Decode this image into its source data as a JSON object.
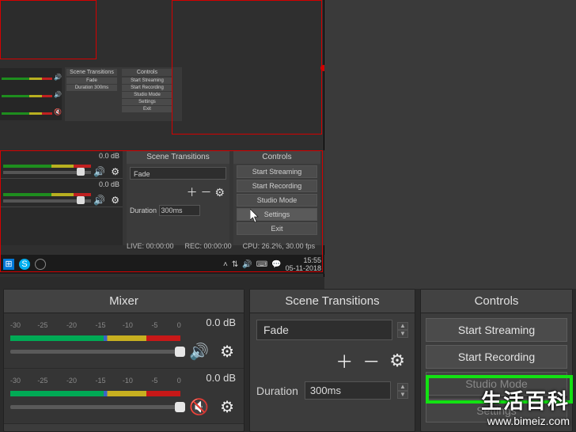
{
  "colors": {
    "accent_red": "#d40000",
    "highlight_green": "#12e212",
    "bg": "#2b2b2b"
  },
  "nested_small": {
    "scene_transitions_header": "Scene Transitions",
    "controls_header": "Controls",
    "transition_name": "Fade",
    "duration_label": "Duration",
    "duration_value": "300ms",
    "controls": [
      "Start Streaming",
      "Start Recording",
      "Studio Mode",
      "Settings",
      "Exit"
    ]
  },
  "nested_medium": {
    "db_labels": [
      "0.0 dB",
      "0.0 dB"
    ],
    "scene_transitions_header": "Scene Transitions",
    "transition_name": "Fade",
    "duration_label": "Duration",
    "duration_value": "300ms",
    "controls_header": "Controls",
    "controls": [
      "Start Streaming",
      "Start Recording",
      "Studio Mode",
      "Settings",
      "Exit"
    ],
    "selected_control_index": 3,
    "status": {
      "live": "LIVE: 00:00:00",
      "rec": "REC: 00:00:00",
      "cpu": "CPU: 26.2%, 30.00 fps"
    },
    "taskbar": {
      "time": "15:55",
      "date": "05-11-2018",
      "tray_icons": [
        "chevron-up",
        "wifi",
        "volume",
        "keyboard",
        "chat"
      ]
    }
  },
  "mixer": {
    "title": "Mixer",
    "channels": [
      {
        "db": "0.0 dB",
        "muted": false,
        "ticks": [
          "-30",
          "-25",
          "-20",
          "-15",
          "-10",
          "-5",
          "0"
        ]
      },
      {
        "db": "0.0 dB",
        "muted": true,
        "ticks": [
          "-30",
          "-25",
          "-20",
          "-15",
          "-10",
          "-5",
          "0"
        ]
      }
    ]
  },
  "scene_transitions": {
    "title": "Scene Transitions",
    "selected": "Fade",
    "duration_label": "Duration",
    "duration_value": "300ms"
  },
  "controls": {
    "title": "Controls",
    "buttons": [
      "Start Streaming",
      "Start Recording",
      "Studio Mode",
      "Settings"
    ]
  },
  "watermark": {
    "cn": "生活百科",
    "url": "www.bimeiz.com"
  }
}
